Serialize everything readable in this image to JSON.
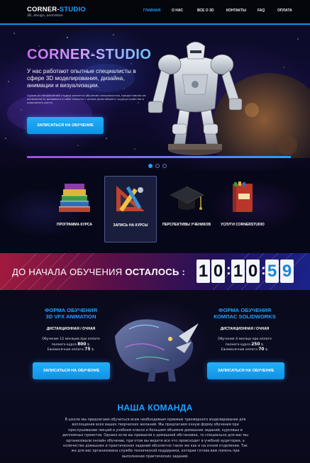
{
  "brand": {
    "name_part1": "CORNER-",
    "name_part2": "STUDIO",
    "subtitle": "3D, design, animation"
  },
  "nav": {
    "items": [
      "ГЛАВНАЯ",
      "О НАС",
      "ВСЕ О 3D",
      "КОНТАКТЫ",
      "FAQ",
      "ОПЛАТА"
    ],
    "active_index": 0
  },
  "hero": {
    "title": "CORNER-STUDIO",
    "lead": "У нас работают опытные специалисты в сфере 3D моделирования, дизайна, анимации и визуализации.",
    "small": "Одним из направлений студии является обучение специалистов, предоставляя им возможность развивать в себе таланты с целью дальнейшего трудоустройства и карьерного роста.",
    "button": "ЗАПИСАТЬСЯ НА ОБУЧЕНИЕ",
    "slide_count": 3,
    "active_slide": 0
  },
  "services": [
    {
      "label": "ПРОГРАММА КУРСА",
      "icon": "books-icon"
    },
    {
      "label": "ЗАПИСЬ НА КУРСЫ",
      "icon": "drawing-tools-icon"
    },
    {
      "label": "ПЕРСПЕКТИВЫ УЧЕНИКОВ",
      "icon": "graduation-cap-icon"
    },
    {
      "label": "УСЛУГИ CORNERSTUDIO",
      "icon": "book-icon"
    }
  ],
  "countdown": {
    "label": "ДО НАЧАЛА ОБУЧЕНИЯ",
    "label_bold": "ОСТАЛОСЬ :",
    "digits": [
      "1",
      "0",
      "1",
      "0",
      "5",
      "9"
    ]
  },
  "courses": [
    {
      "title_line1": "ФОРМА ОБУЧЕНИЯ",
      "title_line2": "3D VFX ANIMATION",
      "mode": "ДИСТАНЦИОННАЯ / ОЧНАЯ",
      "duration": "Обучение 12 месяцев при оплате",
      "full_prefix": "полного курса",
      "full_price": "800",
      "full_suffix": "$.",
      "monthly_prefix": "Ежемесячная оплата",
      "monthly_price": "75",
      "monthly_suffix": "$.",
      "button": "ЗАПИСАТЬСЯ НА ОБУЧЕНИЕ"
    },
    {
      "title_line1": "ФОРМА ОБУЧЕНИЯ",
      "title_line2": "КОМПАС SOLIDWORKS",
      "mode": "ДИСТАНЦИОННАЯ / ОЧНАЯ",
      "duration": "Обучение 4 месяца при оплате",
      "full_prefix": "полного курса",
      "full_price": "250",
      "full_suffix": "$.",
      "monthly_prefix": "Ежемесячная оплата",
      "monthly_price": "70",
      "monthly_suffix": "$.",
      "button": "ЗАПИСАТЬСЯ НА ОБУЧЕНИЕ"
    }
  ],
  "team": {
    "title": "НАША КОМАНДА",
    "text": "В школе мы предлагаем обучиться всем необходимым приемам трехмерного моделирования для воплощения всех ваших творческих желаний. Мы предлагаем очную форму обучения при прослушивании лекций в учебном классе и большим объемом домашних заданий, курсовых и дипломных проектов. Однако если вы привыкли к домашней обстановке, то специально для вас мы организовали онлайн обучение, при этом вы видите все что происходит в учебной аудитории, а количество домашних и практических заданий абсолютно такое же как и на очном отделении. Так же для вас организована служба технической поддержки, которая готова вам помочь при выполнении практических заданий."
  },
  "colors": {
    "accent": "#1aa3ff",
    "hero_title_start": "#c56ef0",
    "hero_title_end": "#6fc5ff",
    "countdown_red": "#be1e46",
    "countdown_blue": "#1e28a0"
  }
}
